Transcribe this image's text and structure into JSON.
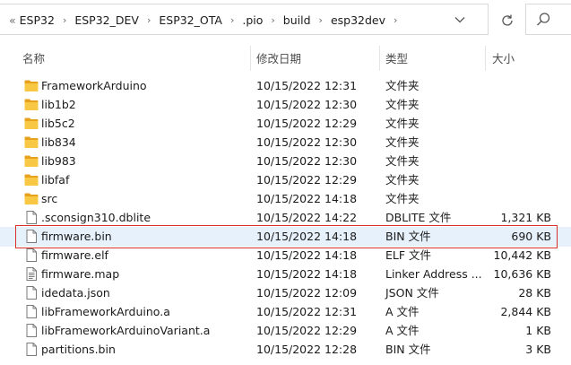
{
  "breadcrumb": {
    "overflow": "«",
    "items": [
      "ESP32",
      "ESP32_DEV",
      "ESP32_OTA",
      ".pio",
      "build",
      "esp32dev"
    ]
  },
  "columns": {
    "name": "名称",
    "date": "修改日期",
    "type": "类型",
    "size": "大小"
  },
  "files": [
    {
      "name": "FrameworkArduino",
      "date": "10/15/2022 12:31",
      "type": "文件夹",
      "size": "",
      "icon": "folder-icon"
    },
    {
      "name": "lib1b2",
      "date": "10/15/2022 12:30",
      "type": "文件夹",
      "size": "",
      "icon": "folder-icon"
    },
    {
      "name": "lib5c2",
      "date": "10/15/2022 12:29",
      "type": "文件夹",
      "size": "",
      "icon": "folder-icon"
    },
    {
      "name": "lib834",
      "date": "10/15/2022 12:30",
      "type": "文件夹",
      "size": "",
      "icon": "folder-icon"
    },
    {
      "name": "lib983",
      "date": "10/15/2022 12:30",
      "type": "文件夹",
      "size": "",
      "icon": "folder-icon"
    },
    {
      "name": "libfaf",
      "date": "10/15/2022 12:29",
      "type": "文件夹",
      "size": "",
      "icon": "folder-icon"
    },
    {
      "name": "src",
      "date": "10/15/2022 14:18",
      "type": "文件夹",
      "size": "",
      "icon": "folder-icon"
    },
    {
      "name": ".sconsign310.dblite",
      "date": "10/15/2022 14:22",
      "type": "DBLITE 文件",
      "size": "1,321 KB",
      "icon": "file-icon"
    },
    {
      "name": "firmware.bin",
      "date": "10/15/2022 14:18",
      "type": "BIN 文件",
      "size": "690 KB",
      "icon": "file-icon",
      "selected": true
    },
    {
      "name": "firmware.elf",
      "date": "10/15/2022 14:18",
      "type": "ELF 文件",
      "size": "10,442 KB",
      "icon": "file-icon"
    },
    {
      "name": "firmware.map",
      "date": "10/15/2022 14:18",
      "type": "Linker Address ...",
      "size": "10,636 KB",
      "icon": "text-file-icon"
    },
    {
      "name": "idedata.json",
      "date": "10/15/2022 12:09",
      "type": "JSON 文件",
      "size": "28 KB",
      "icon": "file-icon"
    },
    {
      "name": "libFrameworkArduino.a",
      "date": "10/15/2022 12:31",
      "type": "A 文件",
      "size": "2,844 KB",
      "icon": "file-icon"
    },
    {
      "name": "libFrameworkArduinoVariant.a",
      "date": "10/15/2022 12:29",
      "type": "A 文件",
      "size": "1 KB",
      "icon": "file-icon"
    },
    {
      "name": "partitions.bin",
      "date": "10/15/2022 12:28",
      "type": "BIN 文件",
      "size": "3 KB",
      "icon": "file-icon"
    }
  ]
}
